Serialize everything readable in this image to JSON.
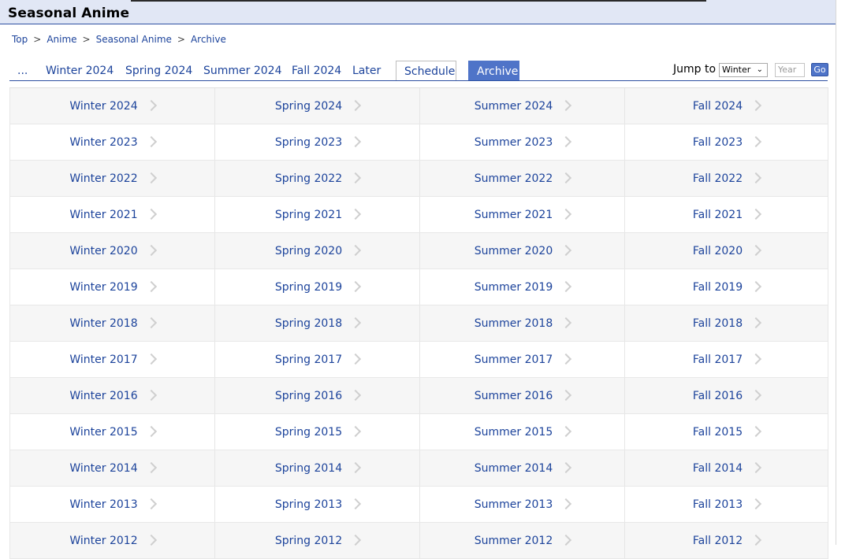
{
  "header": {
    "title": "Seasonal Anime"
  },
  "breadcrumb": [
    "Top",
    "Anime",
    "Seasonal Anime",
    "Archive"
  ],
  "breadcrumb_separator": ">",
  "tabs": [
    "...",
    "Winter 2024",
    "Spring 2024",
    "Summer 2024",
    "Fall 2024",
    "Later",
    "Schedule",
    "Archive"
  ],
  "active_tab": "Archive",
  "jump": {
    "label": "Jump to",
    "season_selected": "Winter",
    "year_placeholder": "Year",
    "go_label": "Go"
  },
  "archive_rows": [
    [
      "Winter 2024",
      "Spring 2024",
      "Summer 2024",
      "Fall 2024"
    ],
    [
      "Winter 2023",
      "Spring 2023",
      "Summer 2023",
      "Fall 2023"
    ],
    [
      "Winter 2022",
      "Spring 2022",
      "Summer 2022",
      "Fall 2022"
    ],
    [
      "Winter 2021",
      "Spring 2021",
      "Summer 2021",
      "Fall 2021"
    ],
    [
      "Winter 2020",
      "Spring 2020",
      "Summer 2020",
      "Fall 2020"
    ],
    [
      "Winter 2019",
      "Spring 2019",
      "Summer 2019",
      "Fall 2019"
    ],
    [
      "Winter 2018",
      "Spring 2018",
      "Summer 2018",
      "Fall 2018"
    ],
    [
      "Winter 2017",
      "Spring 2017",
      "Summer 2017",
      "Fall 2017"
    ],
    [
      "Winter 2016",
      "Spring 2016",
      "Summer 2016",
      "Fall 2016"
    ],
    [
      "Winter 2015",
      "Spring 2015",
      "Summer 2015",
      "Fall 2015"
    ],
    [
      "Winter 2014",
      "Spring 2014",
      "Summer 2014",
      "Fall 2014"
    ],
    [
      "Winter 2013",
      "Spring 2013",
      "Summer 2013",
      "Fall 2013"
    ],
    [
      "Winter 2012",
      "Spring 2012",
      "Summer 2012",
      "Fall 2012"
    ]
  ],
  "colors": {
    "link": "#1c439b",
    "header_bg": "#e1e7f5",
    "accent": "#4f74c8",
    "rule": "#2e51a2",
    "row_shade": "#f6f6f6"
  },
  "icons": {
    "row_link": "chevron-right-icon",
    "select_arrow": "chevron-down-icon"
  }
}
